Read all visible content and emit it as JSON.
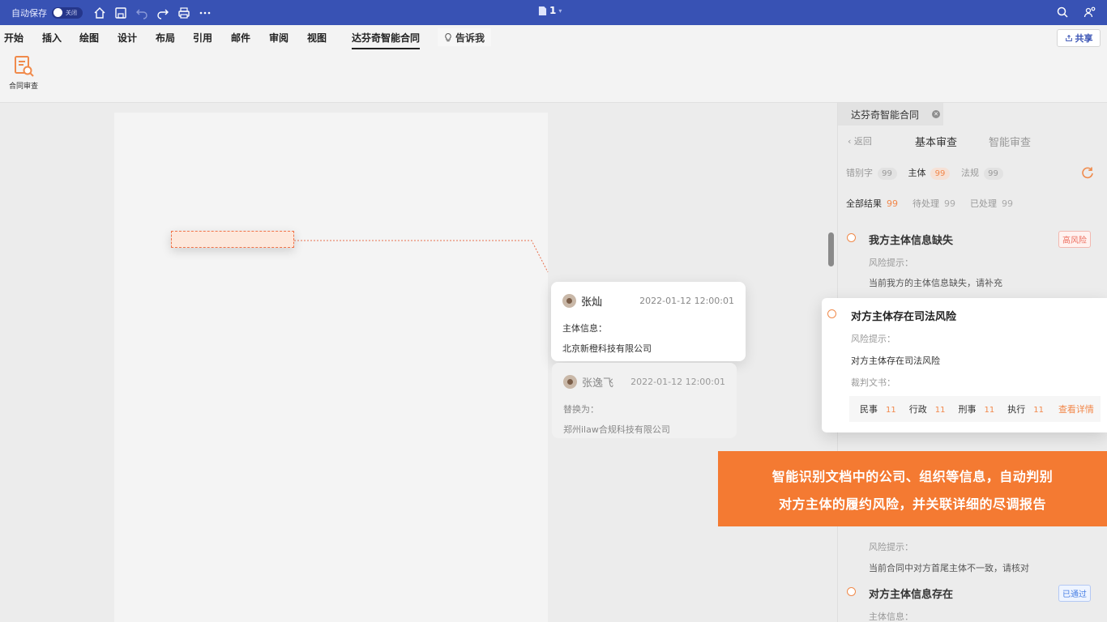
{
  "titlebar": {
    "autosave_label": "自动保存",
    "autosave_state": "关闭",
    "doc_name": "1"
  },
  "ribbon": {
    "tabs": [
      "开始",
      "插入",
      "绘图",
      "设计",
      "布局",
      "引用",
      "邮件",
      "审阅",
      "视图",
      "达芬奇智能合同"
    ],
    "active_tab": "达芬奇智能合同",
    "tell_me": "告诉我",
    "share": "共享",
    "contract_review_button": "合同审查"
  },
  "comments": [
    {
      "author": "张灿",
      "time": "2022-01-12 12:00:01",
      "label": "主体信息：",
      "content": "北京新橙科技有限公司"
    },
    {
      "author": "张逸飞",
      "time": "2022-01-12 12:00:01",
      "label": "替换为：",
      "content": "郑州ilaw合规科技有限公司"
    }
  ],
  "pane": {
    "tab_title": "达芬奇智能合同",
    "back": "返回",
    "sub_tabs": [
      "基本审查",
      "智能审查"
    ],
    "filters": [
      {
        "label": "错别字",
        "count": "99"
      },
      {
        "label": "主体",
        "count": "99"
      },
      {
        "label": "法规",
        "count": "99"
      }
    ],
    "results": [
      {
        "label": "全部结果",
        "count": "99"
      },
      {
        "label": "待处理",
        "count": "99"
      },
      {
        "label": "已处理",
        "count": "99"
      }
    ],
    "items": [
      {
        "title": "我方主体信息缺失",
        "tag": "高风险",
        "hint": "风险提示：",
        "desc": "当前我方的主体信息缺失，请补充"
      },
      {
        "hint": "风险提示：",
        "desc": "当前合同中对方首尾主体不一致，请核对"
      },
      {
        "title": "对方主体信息存在",
        "tag": "已通过",
        "hint": "主体信息："
      }
    ],
    "popup": {
      "title": "对方主体存在司法风险",
      "hint": "风险提示：",
      "desc": "对方主体存在司法风险",
      "doc_label": "裁判文书：",
      "categories": [
        {
          "label": "民事",
          "count": "11"
        },
        {
          "label": "行政",
          "count": "11"
        },
        {
          "label": "刑事",
          "count": "11"
        },
        {
          "label": "执行",
          "count": "11"
        }
      ],
      "link": "查看详情"
    }
  },
  "banner": {
    "line1": "智能识别文档中的公司、组织等信息，自动判别",
    "line2": "对方主体的履约风险，并关联详细的尽调报告"
  },
  "colors": {
    "titlebar": "#3852b4",
    "accent": "#f47a32",
    "risk_red": "#ec6d5e",
    "pass_blue": "#4a80e4"
  }
}
